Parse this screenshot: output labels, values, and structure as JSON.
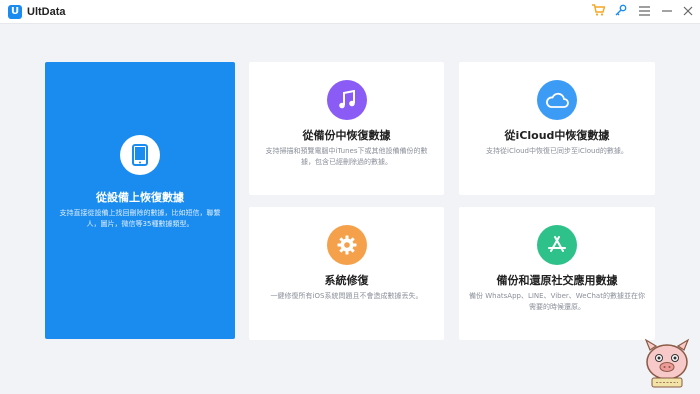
{
  "app": {
    "title": "UltData",
    "logo_letter": "U"
  },
  "titlebar_icons": [
    "cart-icon",
    "key-icon",
    "menu-icon",
    "minimize-icon",
    "close-icon"
  ],
  "cards": [
    {
      "title": "從設備上恢復數據",
      "desc": "支持直接從設備上找回刪除的數據，比如短信，聯繫人，圖片，微信等35種數據類型。",
      "icon": "phone-icon",
      "selected": true,
      "accent": "#1a8cf0"
    },
    {
      "title": "從備份中恢復數據",
      "desc": "支持掃描和預覽電腦中iTunes下或其他設備備份的數據，包含已經刪除過的數據。",
      "icon": "music-note-icon",
      "accent": "#8a5cf5"
    },
    {
      "title": "從iCloud中恢復數據",
      "desc": "支持從iCloud中恢復已同步至iCloud的數據。",
      "icon": "cloud-icon",
      "accent": "#3b9bf5"
    },
    {
      "title": "系統修復",
      "desc": "一鍵修復所有iOS系統問題且不會造成數據丟失。",
      "icon": "gear-icon",
      "accent": "#f5a04a"
    },
    {
      "title": "備份和還原社交應用數據",
      "desc": "備份 WhatsApp、LINE、Viber、WeChat的數據並在你需要的時候還原。",
      "icon": "app-store-icon",
      "accent": "#2ec28a"
    }
  ]
}
